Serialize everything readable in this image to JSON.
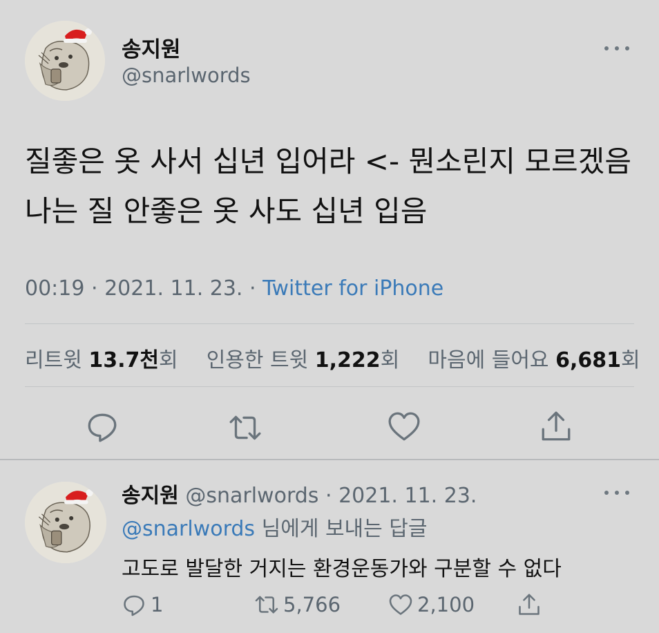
{
  "main_tweet": {
    "display_name": "송지원",
    "handle": "@snarlwords",
    "text": "질좋은 옷 사서 십년 입어라 <- 뭔소린지 모르겠음 나는 질 안좋은 옷 사도 십년 입음",
    "time": "00:19",
    "date": "2021. 11. 23.",
    "source": "Twitter for iPhone",
    "stats": {
      "retweets_label": "리트윗",
      "retweets_value": "13.7천",
      "retweets_unit": "회",
      "quotes_label": "인용한 트윗",
      "quotes_value": "1,222",
      "quotes_unit": "회",
      "likes_label": "마음에 들어요",
      "likes_value": "6,681",
      "likes_unit": "회"
    },
    "actions": [
      "reply-icon",
      "retweet-icon",
      "like-icon",
      "share-icon"
    ]
  },
  "reply_tweet": {
    "display_name": "송지원",
    "handle": "@snarlwords",
    "date": "2021. 11. 23.",
    "reply_to_mention": "@snarlwords",
    "reply_to_suffix": "님에게 보내는 답글",
    "text": "고도로 발달한 거지는 환경운동가와 구분할 수 없다",
    "replies": "1",
    "retweets": "5,766",
    "likes": "2,100"
  },
  "colors": {
    "background": "#d9d9d9",
    "link": "#3a7ab8",
    "muted": "#5b6670",
    "text": "#111111",
    "santa_hat": "#d81e1e"
  }
}
